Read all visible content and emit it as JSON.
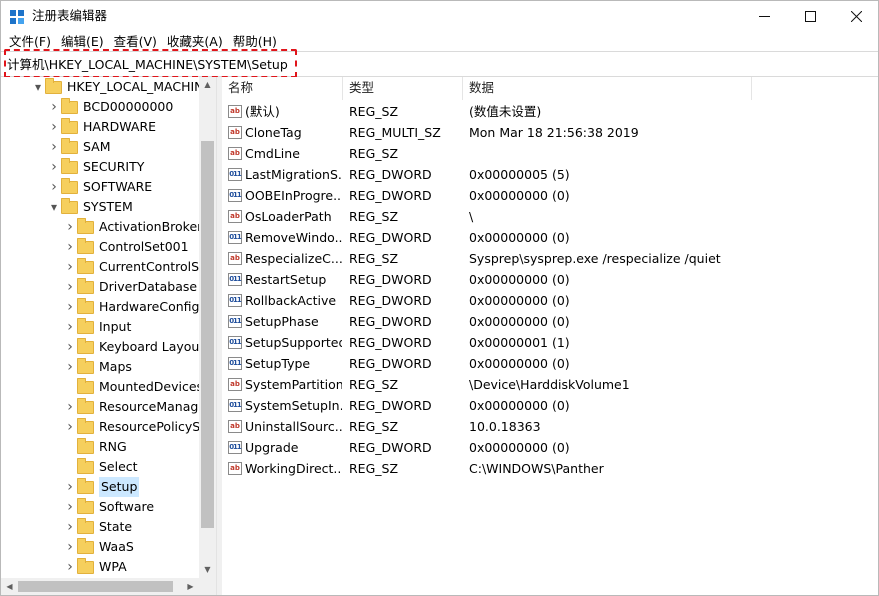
{
  "window": {
    "title": "注册表编辑器",
    "controls": {
      "minimize": "—",
      "maximize": "☐",
      "close": "✕"
    }
  },
  "menu": [
    "文件(F)",
    "编辑(E)",
    "查看(V)",
    "收藏夹(A)",
    "帮助(H)"
  ],
  "address": "计算机\\HKEY_LOCAL_MACHINE\\SYSTEM\\Setup",
  "tree": [
    {
      "label": "HKEY_LOCAL_MACHINE",
      "level": 0,
      "expander": "expanded"
    },
    {
      "label": "BCD00000000",
      "level": 1,
      "expander": "collapsed"
    },
    {
      "label": "HARDWARE",
      "level": 1,
      "expander": "collapsed"
    },
    {
      "label": "SAM",
      "level": 1,
      "expander": "collapsed"
    },
    {
      "label": "SECURITY",
      "level": 1,
      "expander": "collapsed"
    },
    {
      "label": "SOFTWARE",
      "level": 1,
      "expander": "collapsed"
    },
    {
      "label": "SYSTEM",
      "level": 1,
      "expander": "expanded"
    },
    {
      "label": "ActivationBroker",
      "level": 2,
      "expander": "collapsed"
    },
    {
      "label": "ControlSet001",
      "level": 2,
      "expander": "collapsed"
    },
    {
      "label": "CurrentControlSet",
      "level": 2,
      "expander": "collapsed"
    },
    {
      "label": "DriverDatabase",
      "level": 2,
      "expander": "collapsed"
    },
    {
      "label": "HardwareConfig",
      "level": 2,
      "expander": "collapsed"
    },
    {
      "label": "Input",
      "level": 2,
      "expander": "collapsed"
    },
    {
      "label": "Keyboard Layout",
      "level": 2,
      "expander": "collapsed"
    },
    {
      "label": "Maps",
      "level": 2,
      "expander": "collapsed"
    },
    {
      "label": "MountedDevices",
      "level": 2,
      "expander": "none"
    },
    {
      "label": "ResourceManager",
      "level": 2,
      "expander": "collapsed"
    },
    {
      "label": "ResourcePolicySto",
      "level": 2,
      "expander": "collapsed"
    },
    {
      "label": "RNG",
      "level": 2,
      "expander": "none"
    },
    {
      "label": "Select",
      "level": 2,
      "expander": "none"
    },
    {
      "label": "Setup",
      "level": 2,
      "expander": "collapsed",
      "selected": true
    },
    {
      "label": "Software",
      "level": 2,
      "expander": "collapsed"
    },
    {
      "label": "State",
      "level": 2,
      "expander": "collapsed"
    },
    {
      "label": "WaaS",
      "level": 2,
      "expander": "collapsed"
    },
    {
      "label": "WPA",
      "level": 2,
      "expander": "collapsed"
    }
  ],
  "columns": {
    "name": "名称",
    "type": "类型",
    "data": "数据"
  },
  "values": [
    {
      "name": "(默认)",
      "type": "REG_SZ",
      "data": "(数值未设置)",
      "icon": "string-value-icon"
    },
    {
      "name": "CloneTag",
      "type": "REG_MULTI_SZ",
      "data": "Mon Mar 18 21:56:38 2019",
      "icon": "string-value-icon"
    },
    {
      "name": "CmdLine",
      "type": "REG_SZ",
      "data": "",
      "icon": "string-value-icon"
    },
    {
      "name": "LastMigrationS...",
      "type": "REG_DWORD",
      "data": "0x00000005 (5)",
      "icon": "binary-value-icon"
    },
    {
      "name": "OOBEInProgre...",
      "type": "REG_DWORD",
      "data": "0x00000000 (0)",
      "icon": "binary-value-icon"
    },
    {
      "name": "OsLoaderPath",
      "type": "REG_SZ",
      "data": "\\",
      "icon": "string-value-icon"
    },
    {
      "name": "RemoveWindo...",
      "type": "REG_DWORD",
      "data": "0x00000000 (0)",
      "icon": "binary-value-icon"
    },
    {
      "name": "RespecializeC...",
      "type": "REG_SZ",
      "data": "Sysprep\\sysprep.exe /respecialize /quiet",
      "icon": "string-value-icon"
    },
    {
      "name": "RestartSetup",
      "type": "REG_DWORD",
      "data": "0x00000000 (0)",
      "icon": "binary-value-icon"
    },
    {
      "name": "RollbackActive",
      "type": "REG_DWORD",
      "data": "0x00000000 (0)",
      "icon": "binary-value-icon"
    },
    {
      "name": "SetupPhase",
      "type": "REG_DWORD",
      "data": "0x00000000 (0)",
      "icon": "binary-value-icon"
    },
    {
      "name": "SetupSupported",
      "type": "REG_DWORD",
      "data": "0x00000001 (1)",
      "icon": "binary-value-icon"
    },
    {
      "name": "SetupType",
      "type": "REG_DWORD",
      "data": "0x00000000 (0)",
      "icon": "binary-value-icon"
    },
    {
      "name": "SystemPartition",
      "type": "REG_SZ",
      "data": "\\Device\\HarddiskVolume1",
      "icon": "string-value-icon"
    },
    {
      "name": "SystemSetupIn...",
      "type": "REG_DWORD",
      "data": "0x00000000 (0)",
      "icon": "binary-value-icon"
    },
    {
      "name": "UninstallSourc...",
      "type": "REG_SZ",
      "data": "10.0.18363",
      "icon": "string-value-icon"
    },
    {
      "name": "Upgrade",
      "type": "REG_DWORD",
      "data": "0x00000000 (0)",
      "icon": "binary-value-icon"
    },
    {
      "name": "WorkingDirect...",
      "type": "REG_SZ",
      "data": "C:\\WINDOWS\\Panther",
      "icon": "string-value-icon"
    }
  ],
  "colors": {
    "selection": "#cce8ff",
    "highlight_border": "#e0151b",
    "folder": "#f6cf5d"
  }
}
